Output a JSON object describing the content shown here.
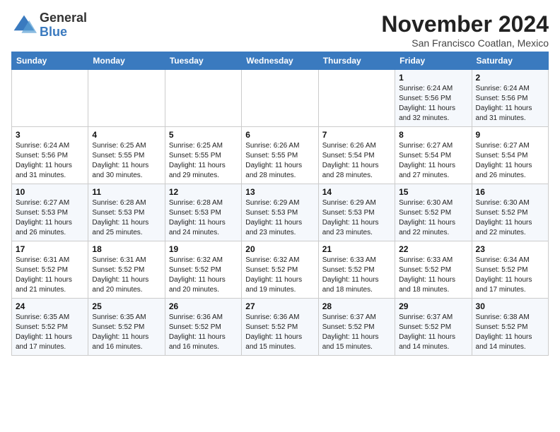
{
  "logo": {
    "general": "General",
    "blue": "Blue"
  },
  "header": {
    "month": "November 2024",
    "location": "San Francisco Coatlan, Mexico"
  },
  "weekdays": [
    "Sunday",
    "Monday",
    "Tuesday",
    "Wednesday",
    "Thursday",
    "Friday",
    "Saturday"
  ],
  "weeks": [
    [
      {
        "day": "",
        "info": ""
      },
      {
        "day": "",
        "info": ""
      },
      {
        "day": "",
        "info": ""
      },
      {
        "day": "",
        "info": ""
      },
      {
        "day": "",
        "info": ""
      },
      {
        "day": "1",
        "info": "Sunrise: 6:24 AM\nSunset: 5:56 PM\nDaylight: 11 hours and 32 minutes."
      },
      {
        "day": "2",
        "info": "Sunrise: 6:24 AM\nSunset: 5:56 PM\nDaylight: 11 hours and 31 minutes."
      }
    ],
    [
      {
        "day": "3",
        "info": "Sunrise: 6:24 AM\nSunset: 5:56 PM\nDaylight: 11 hours and 31 minutes."
      },
      {
        "day": "4",
        "info": "Sunrise: 6:25 AM\nSunset: 5:55 PM\nDaylight: 11 hours and 30 minutes."
      },
      {
        "day": "5",
        "info": "Sunrise: 6:25 AM\nSunset: 5:55 PM\nDaylight: 11 hours and 29 minutes."
      },
      {
        "day": "6",
        "info": "Sunrise: 6:26 AM\nSunset: 5:55 PM\nDaylight: 11 hours and 28 minutes."
      },
      {
        "day": "7",
        "info": "Sunrise: 6:26 AM\nSunset: 5:54 PM\nDaylight: 11 hours and 28 minutes."
      },
      {
        "day": "8",
        "info": "Sunrise: 6:27 AM\nSunset: 5:54 PM\nDaylight: 11 hours and 27 minutes."
      },
      {
        "day": "9",
        "info": "Sunrise: 6:27 AM\nSunset: 5:54 PM\nDaylight: 11 hours and 26 minutes."
      }
    ],
    [
      {
        "day": "10",
        "info": "Sunrise: 6:27 AM\nSunset: 5:53 PM\nDaylight: 11 hours and 26 minutes."
      },
      {
        "day": "11",
        "info": "Sunrise: 6:28 AM\nSunset: 5:53 PM\nDaylight: 11 hours and 25 minutes."
      },
      {
        "day": "12",
        "info": "Sunrise: 6:28 AM\nSunset: 5:53 PM\nDaylight: 11 hours and 24 minutes."
      },
      {
        "day": "13",
        "info": "Sunrise: 6:29 AM\nSunset: 5:53 PM\nDaylight: 11 hours and 23 minutes."
      },
      {
        "day": "14",
        "info": "Sunrise: 6:29 AM\nSunset: 5:53 PM\nDaylight: 11 hours and 23 minutes."
      },
      {
        "day": "15",
        "info": "Sunrise: 6:30 AM\nSunset: 5:52 PM\nDaylight: 11 hours and 22 minutes."
      },
      {
        "day": "16",
        "info": "Sunrise: 6:30 AM\nSunset: 5:52 PM\nDaylight: 11 hours and 22 minutes."
      }
    ],
    [
      {
        "day": "17",
        "info": "Sunrise: 6:31 AM\nSunset: 5:52 PM\nDaylight: 11 hours and 21 minutes."
      },
      {
        "day": "18",
        "info": "Sunrise: 6:31 AM\nSunset: 5:52 PM\nDaylight: 11 hours and 20 minutes."
      },
      {
        "day": "19",
        "info": "Sunrise: 6:32 AM\nSunset: 5:52 PM\nDaylight: 11 hours and 20 minutes."
      },
      {
        "day": "20",
        "info": "Sunrise: 6:32 AM\nSunset: 5:52 PM\nDaylight: 11 hours and 19 minutes."
      },
      {
        "day": "21",
        "info": "Sunrise: 6:33 AM\nSunset: 5:52 PM\nDaylight: 11 hours and 18 minutes."
      },
      {
        "day": "22",
        "info": "Sunrise: 6:33 AM\nSunset: 5:52 PM\nDaylight: 11 hours and 18 minutes."
      },
      {
        "day": "23",
        "info": "Sunrise: 6:34 AM\nSunset: 5:52 PM\nDaylight: 11 hours and 17 minutes."
      }
    ],
    [
      {
        "day": "24",
        "info": "Sunrise: 6:35 AM\nSunset: 5:52 PM\nDaylight: 11 hours and 17 minutes."
      },
      {
        "day": "25",
        "info": "Sunrise: 6:35 AM\nSunset: 5:52 PM\nDaylight: 11 hours and 16 minutes."
      },
      {
        "day": "26",
        "info": "Sunrise: 6:36 AM\nSunset: 5:52 PM\nDaylight: 11 hours and 16 minutes."
      },
      {
        "day": "27",
        "info": "Sunrise: 6:36 AM\nSunset: 5:52 PM\nDaylight: 11 hours and 15 minutes."
      },
      {
        "day": "28",
        "info": "Sunrise: 6:37 AM\nSunset: 5:52 PM\nDaylight: 11 hours and 15 minutes."
      },
      {
        "day": "29",
        "info": "Sunrise: 6:37 AM\nSunset: 5:52 PM\nDaylight: 11 hours and 14 minutes."
      },
      {
        "day": "30",
        "info": "Sunrise: 6:38 AM\nSunset: 5:52 PM\nDaylight: 11 hours and 14 minutes."
      }
    ]
  ]
}
